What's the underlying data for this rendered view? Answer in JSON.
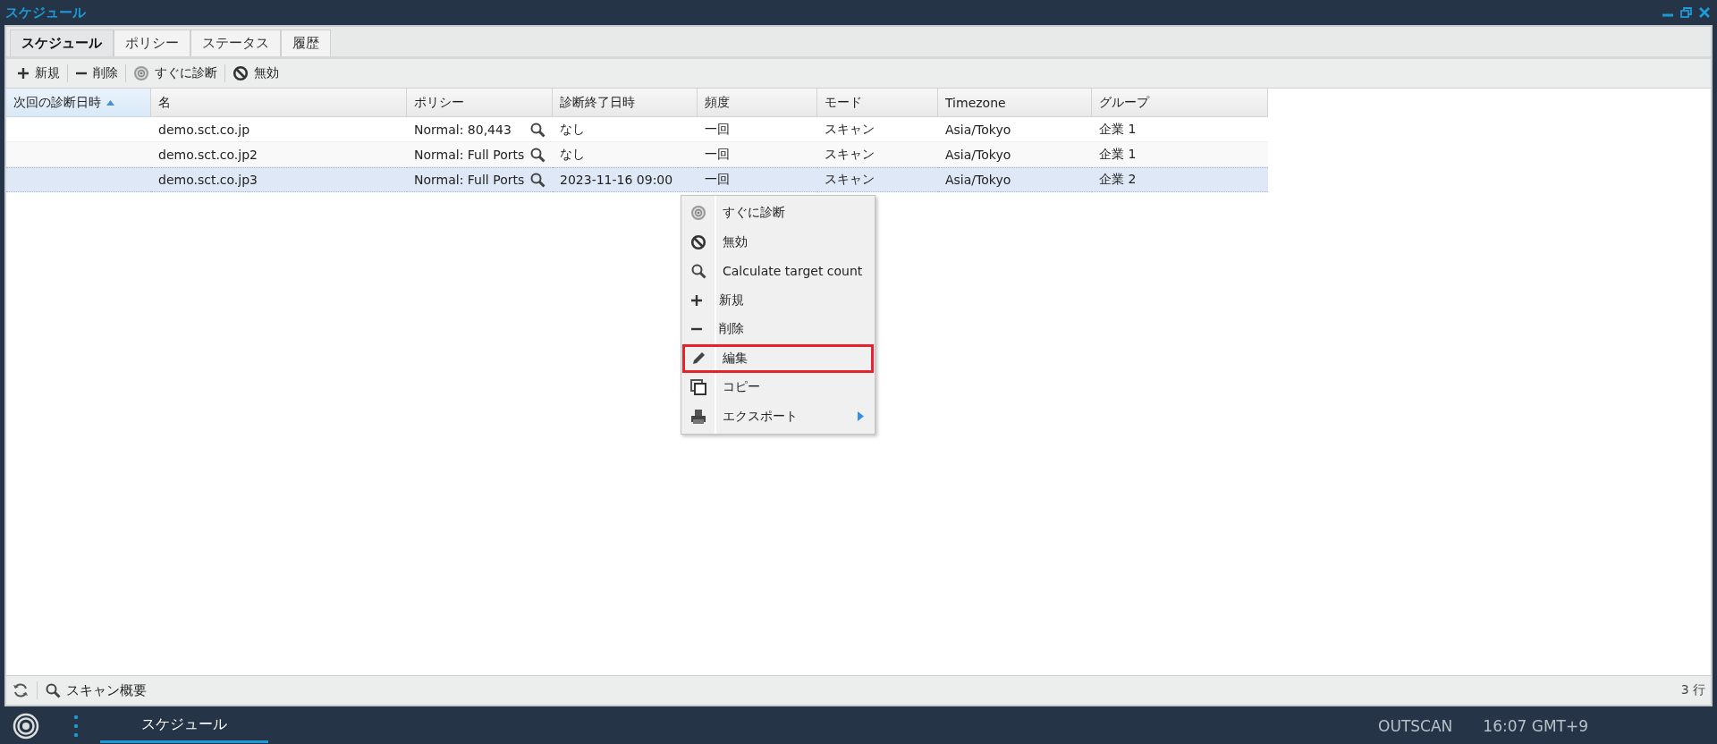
{
  "window": {
    "title": "スケジュール"
  },
  "tabs": [
    {
      "label": "スケジュール",
      "selected": true
    },
    {
      "label": "ポリシー",
      "selected": false
    },
    {
      "label": "ステータス",
      "selected": false
    },
    {
      "label": "履歴",
      "selected": false
    }
  ],
  "toolbar": [
    {
      "label": "新規"
    },
    {
      "label": "削除"
    },
    {
      "label": "すぐに診断"
    },
    {
      "label": "無効"
    }
  ],
  "table": {
    "columns": [
      {
        "label": "次回の診断日時",
        "sorted_ascending": true
      },
      {
        "label": "名"
      },
      {
        "label": "ポリシー"
      },
      {
        "label": "診断終了日時"
      },
      {
        "label": "頻度"
      },
      {
        "label": "モード"
      },
      {
        "label": "Timezone"
      },
      {
        "label": "グループ"
      }
    ],
    "rows": [
      {
        "name": "demo.sct.co.jp",
        "policy": "Normal: 80,443",
        "finished": "なし",
        "frequency": "一回",
        "mode": "スキャン",
        "timezone": "Asia/Tokyo",
        "group": "企業 1",
        "selected": false
      },
      {
        "name": "demo.sct.co.jp2",
        "policy": "Normal: Full Ports",
        "finished": "なし",
        "frequency": "一回",
        "mode": "スキャン",
        "timezone": "Asia/Tokyo",
        "group": "企業 1",
        "selected": false
      },
      {
        "name": "demo.sct.co.jp3",
        "policy": "Normal: Full Ports",
        "finished": "2023-11-16 09:00",
        "frequency": "一回",
        "mode": "スキャン",
        "timezone": "Asia/Tokyo",
        "group": "企業 2",
        "selected": true
      }
    ]
  },
  "context_menu": {
    "items": [
      {
        "label": "すぐに診断",
        "highlighted": false,
        "has_submenu": false
      },
      {
        "label": "無効",
        "highlighted": false,
        "has_submenu": false
      },
      {
        "label": "Calculate target count",
        "highlighted": false,
        "has_submenu": false
      },
      {
        "label": "新規",
        "highlighted": false,
        "has_submenu": false
      },
      {
        "label": "削除",
        "highlighted": false,
        "has_submenu": false
      },
      {
        "label": "編集",
        "highlighted": true,
        "has_submenu": false
      },
      {
        "label": "コピー",
        "highlighted": false,
        "has_submenu": false
      },
      {
        "label": "エクスポート",
        "highlighted": false,
        "has_submenu": true
      }
    ]
  },
  "status_bar": {
    "link": "スキャン概要",
    "row_count": "3 行"
  },
  "taskbar": {
    "tasks": [
      {
        "label": "スケジュール",
        "selected": true
      }
    ],
    "product": "OUTSCAN",
    "clock": "16:07 GMT+9"
  }
}
